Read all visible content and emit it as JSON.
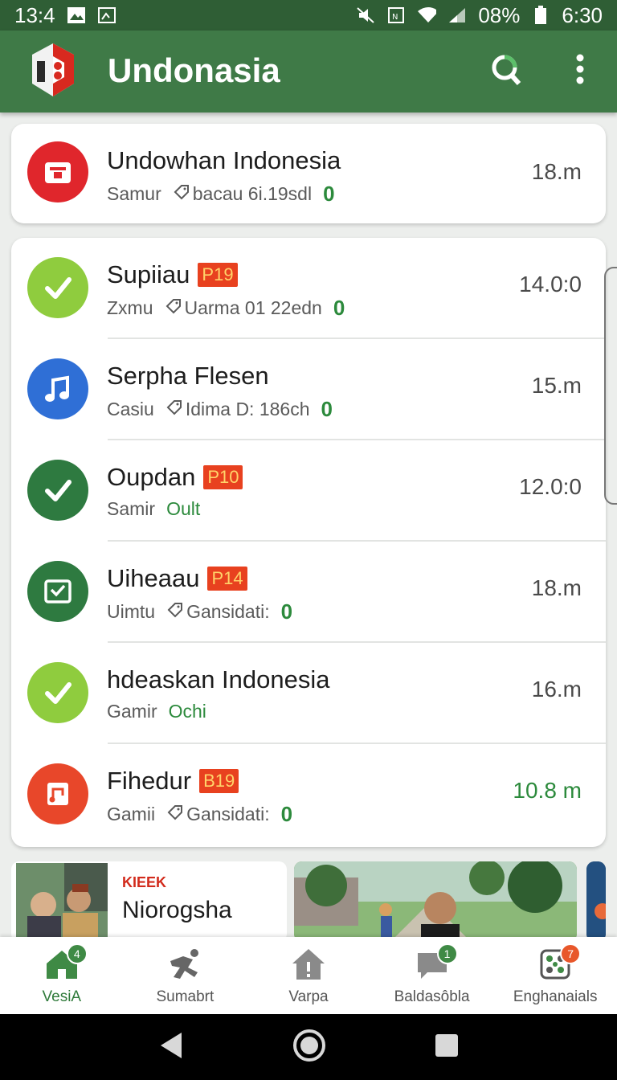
{
  "status_bar": {
    "left_time": "13:4",
    "battery": "08%",
    "right_time": "6:30"
  },
  "app_bar": {
    "title": "Undonasia",
    "search_icon": "search-icon",
    "menu_icon": "more-vert-icon",
    "brand_color": "#3f7a47"
  },
  "featured": {
    "title": "Undowhan Indonesia",
    "subtitle_name": "Samur",
    "subtitle_detail": "bacau 6i.19sdl",
    "count": "0",
    "time": "18.m",
    "icon": "inbox-icon",
    "icon_color": "#e0262c"
  },
  "list": [
    {
      "title": "Supiiau",
      "tag": "P19",
      "name": "Zxmu",
      "detail": "Uarma 01 22edn",
      "count": "0",
      "status": "",
      "time": "14.0:0",
      "icon": "check-icon",
      "icon_color": "#8fcc3e"
    },
    {
      "title": "Serpha Flesen",
      "tag": "",
      "name": "Casiu",
      "detail": "Idima D: 186ch",
      "count": "0",
      "status": "",
      "time": "15.m",
      "icon": "music-note-icon",
      "icon_color": "#2f6fd6"
    },
    {
      "title": "Oupdan",
      "tag": "P10",
      "name": "Samir",
      "detail": "",
      "count": "",
      "status": "Oult",
      "time": "12.0:0",
      "icon": "check-icon",
      "icon_color": "#2e7a40"
    },
    {
      "title": "Uiheaau",
      "tag": "P14",
      "name": "Uimtu",
      "detail": "Gansidati:",
      "count": "0",
      "status": "",
      "time": "18.m",
      "icon": "mail-check-icon",
      "icon_color": "#2e7a40"
    },
    {
      "title": "hdeaskan Indonesia",
      "tag": "",
      "name": "Gamir",
      "detail": "",
      "count": "",
      "status": "Ochi",
      "time": "16.m",
      "icon": "check-icon",
      "icon_color": "#8fcc3e"
    },
    {
      "title": "Fihedur",
      "tag": "B19",
      "name": "Gamii",
      "detail": "Gansidati:",
      "count": "0",
      "status": "",
      "time": "10.8 m",
      "icon": "music-sheet-icon",
      "icon_color": "#e8472a"
    }
  ],
  "promo": {
    "kicker": "KIEEK",
    "headline": "Niorogsha"
  },
  "bottom_nav": [
    {
      "label": "VesiA",
      "icon": "home-icon",
      "badge": "4",
      "badge_color": "#3f8a45"
    },
    {
      "label": "Sumabrt",
      "icon": "runner-icon",
      "badge": "",
      "badge_color": ""
    },
    {
      "label": "Varpa",
      "icon": "house-alert-icon",
      "badge": "",
      "badge_color": ""
    },
    {
      "label": "Baldasôbla",
      "icon": "chat-icon",
      "badge": "1",
      "badge_color": "#3f8a45"
    },
    {
      "label": "Enghanaials",
      "icon": "grid-dots-icon",
      "badge": "7",
      "badge_color": "#e8572a"
    }
  ]
}
